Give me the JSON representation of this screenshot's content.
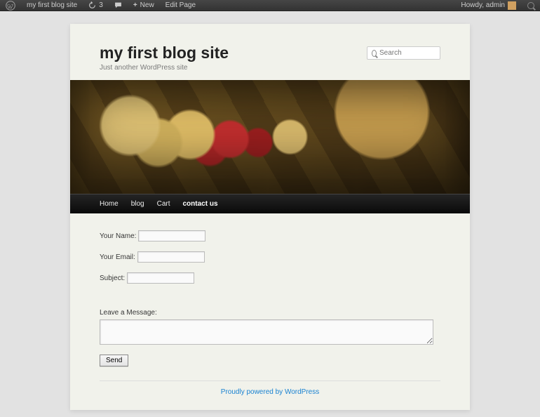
{
  "adminbar": {
    "site_name": "my first blog site",
    "updates_count": "3",
    "new_label": "New",
    "edit_label": "Edit Page",
    "greeting": "Howdy, admin"
  },
  "header": {
    "title": "my first blog site",
    "tagline": "Just another WordPress site",
    "search_placeholder": "Search"
  },
  "nav": {
    "items": [
      {
        "label": "Home"
      },
      {
        "label": "blog"
      },
      {
        "label": "Cart"
      },
      {
        "label": "contact us"
      }
    ],
    "active_index": 3
  },
  "form": {
    "name_label": "Your Name:",
    "email_label": "Your Email:",
    "subject_label": "Subject:",
    "message_label": "Leave a Message:",
    "submit_label": "Send"
  },
  "footer": {
    "text": "Proudly powered by WordPress"
  }
}
